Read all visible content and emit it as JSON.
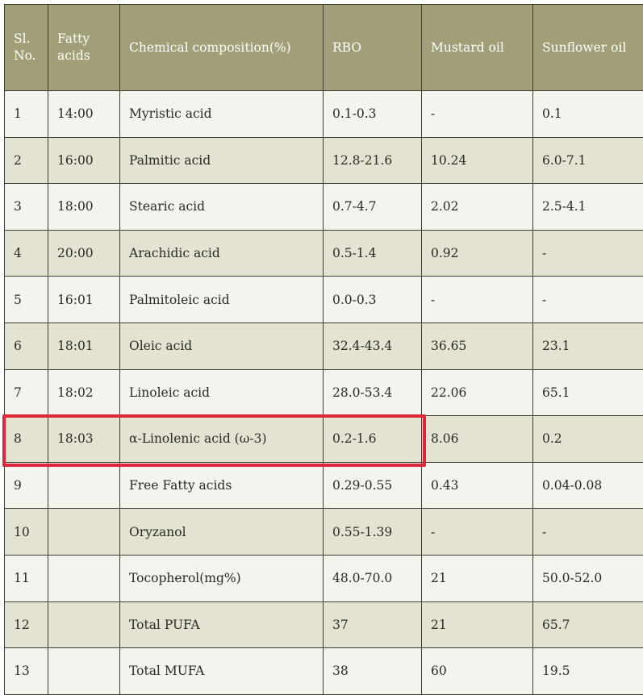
{
  "table": {
    "headers": [
      "Sl. No.",
      "Fatty acids",
      "Chemical composition(%)",
      "RBO",
      "Mustard oil",
      "Sunflower oil"
    ],
    "rows": [
      [
        "1",
        "14:00",
        "Myristic acid",
        "0.1-0.3",
        "-",
        "0.1"
      ],
      [
        "2",
        "16:00",
        "Palmitic acid",
        "12.8-21.6",
        "10.24",
        "6.0-7.1"
      ],
      [
        "3",
        "18:00",
        "Stearic acid",
        "0.7-4.7",
        "2.02",
        "2.5-4.1"
      ],
      [
        "4",
        "20:00",
        "Arachidic acid",
        "0.5-1.4",
        "0.92",
        "-"
      ],
      [
        "5",
        "16:01",
        "Palmitoleic acid",
        "0.0-0.3",
        "-",
        "-"
      ],
      [
        "6",
        "18:01",
        "Oleic acid",
        "32.4-43.4",
        "36.65",
        "23.1"
      ],
      [
        "7",
        "18:02",
        "Linoleic acid",
        "28.0-53.4",
        "22.06",
        "65.1"
      ],
      [
        "8",
        "18:03",
        "α-Linolenic acid (ω-3)",
        "0.2-1.6",
        "8.06",
        "0.2"
      ],
      [
        "9",
        "",
        "Free Fatty acids",
        "0.29-0.55",
        "0.43",
        "0.04-0.08"
      ],
      [
        "10",
        "",
        "Oryzanol",
        "0.55-1.39",
        "-",
        "-"
      ],
      [
        "11",
        "",
        "Tocopherol(mg%)",
        "48.0-70.0",
        "21",
        "50.0-52.0"
      ],
      [
        "12",
        "",
        "Total PUFA",
        "37",
        "21",
        "65.7"
      ],
      [
        "13",
        "",
        "Total MUFA",
        "38",
        "60",
        "19.5"
      ]
    ],
    "highlighted_row_index": 7
  },
  "colors": {
    "header_bg": "#a19e78",
    "header_text": "#ffffff",
    "row_light": "#f4f4ee",
    "row_dark": "#e4e3d2",
    "border": "#3e3e30",
    "highlight": "#e0243a"
  }
}
